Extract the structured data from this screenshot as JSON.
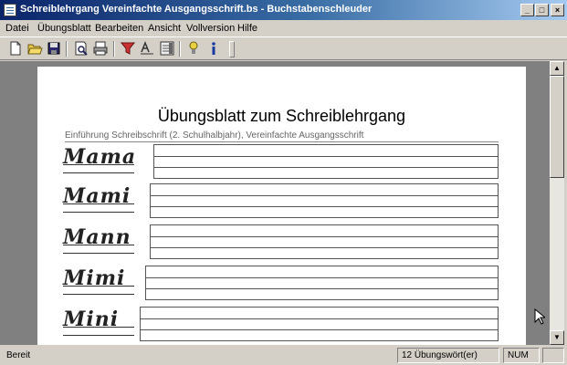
{
  "window": {
    "title": "Schreiblehrgang Vereinfachte Ausgangsschrift.bs - Buchstabenschleuder",
    "buttons": [
      "minimize",
      "maximize",
      "close"
    ]
  },
  "menu": [
    "Datei",
    "Übungsblatt",
    "Bearbeiten",
    "Ansicht",
    "Vollversion",
    "Hilfe"
  ],
  "toolbar": {
    "icons": [
      "new-icon",
      "open-icon",
      "save-icon",
      "print-preview-icon",
      "print-icon",
      "filter-icon",
      "letter-style-icon",
      "worksheet-icon",
      "hint-icon",
      "info-icon"
    ]
  },
  "document": {
    "title": "Übungsblatt zum Schreiblehrgang",
    "subtitle": "Einführung Schreibschrift (2. Schulhalbjahr), Vereinfachte Ausgangsschrift",
    "words": [
      "Mama",
      "Mami",
      "Mann",
      "Mimi",
      "Mini"
    ]
  },
  "statusbar": {
    "status": "Bereit",
    "count": "12 Übungswört(er)",
    "num": "NUM"
  }
}
